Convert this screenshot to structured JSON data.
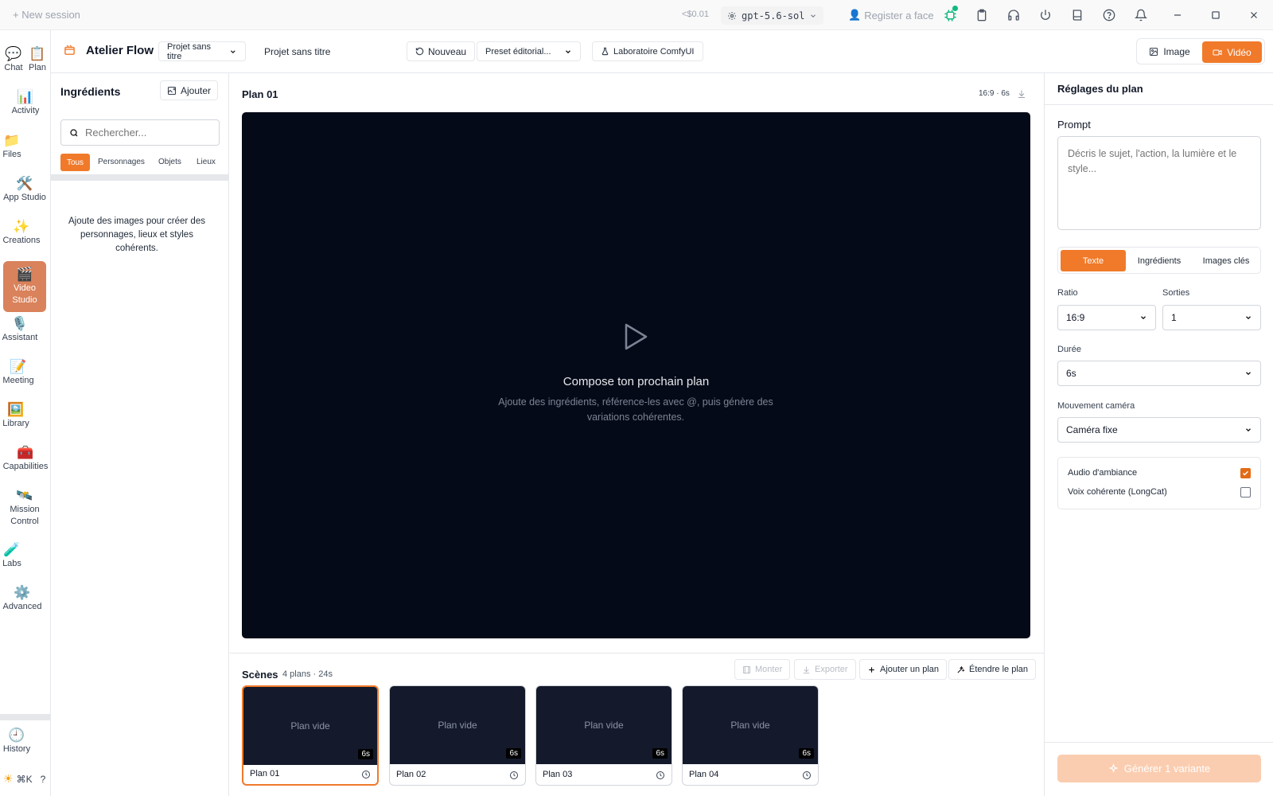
{
  "titlebar": {
    "new_session": "New session",
    "cost": "<$0.01",
    "model": "gpt-5.6-sol",
    "register_face": "Register a face"
  },
  "nav": {
    "chat": "Chat",
    "plan": "Plan",
    "activity": "Activity",
    "files": "Files",
    "app_studio": "App Studio",
    "creations": "Creations",
    "video_studio_line1": "Video",
    "video_studio_line2": "Studio",
    "assistant": "Assistant",
    "meeting": "Meeting",
    "library": "Library",
    "capabilities": "Capabilities",
    "mission_line1": "Mission",
    "mission_line2": "Control",
    "labs": "Labs",
    "advanced": "Advanced",
    "history": "History",
    "shortcut": "⌘K",
    "help": "?"
  },
  "header": {
    "app_name": "Atelier Flow",
    "project_select": "Projet sans titre",
    "project_name": "Projet sans titre",
    "new_button": "Nouveau",
    "preset_select": "Preset éditorial...",
    "lab_button": "Laboratoire ComfyUI",
    "mode_image": "Image",
    "mode_video": "Vidéo"
  },
  "ingredients": {
    "title": "Ingrédients",
    "add_button": "Ajouter",
    "search_placeholder": "Rechercher...",
    "tabs": [
      "Tous",
      "Personnages",
      "Objets",
      "Lieux"
    ],
    "empty_text": "Ajoute des images pour créer des personnages, lieux et styles cohérents."
  },
  "preview": {
    "plan_title": "Plan 01",
    "meta": "16:9 · 6s",
    "empty_title": "Compose ton prochain plan",
    "empty_text": "Ajoute des ingrédients, référence-les avec @, puis génère des variations cohérentes."
  },
  "scenes": {
    "title": "Scènes",
    "meta": "4 plans · 24s",
    "monter": "Monter",
    "exporter": "Exporter",
    "add_plan": "Ajouter un plan",
    "extend_plan": "Étendre le plan",
    "empty_label": "Plan vide",
    "duration": "6s",
    "plans": [
      "Plan 01",
      "Plan 02",
      "Plan 03",
      "Plan 04"
    ]
  },
  "settings": {
    "title": "Réglages du plan",
    "prompt_label": "Prompt",
    "prompt_placeholder": "Décris le sujet, l'action, la lumière et le style...",
    "tabs": [
      "Texte",
      "Ingrédients",
      "Images clés"
    ],
    "ratio_label": "Ratio",
    "ratio_value": "16:9",
    "outputs_label": "Sorties",
    "outputs_value": "1",
    "duration_label": "Durée",
    "duration_value": "6s",
    "camera_label": "Mouvement caméra",
    "camera_value": "Caméra fixe",
    "audio_label": "Audio d'ambiance",
    "audio_checked": true,
    "voice_label": "Voix cohérente (LongCat)",
    "voice_checked": false,
    "generate_button": "Générer 1 variante"
  },
  "colors": {
    "accent": "#f07a2a",
    "active_nav": "#d9825b",
    "preview_bg": "#050a18",
    "thumb_bg": "#141a2b"
  }
}
